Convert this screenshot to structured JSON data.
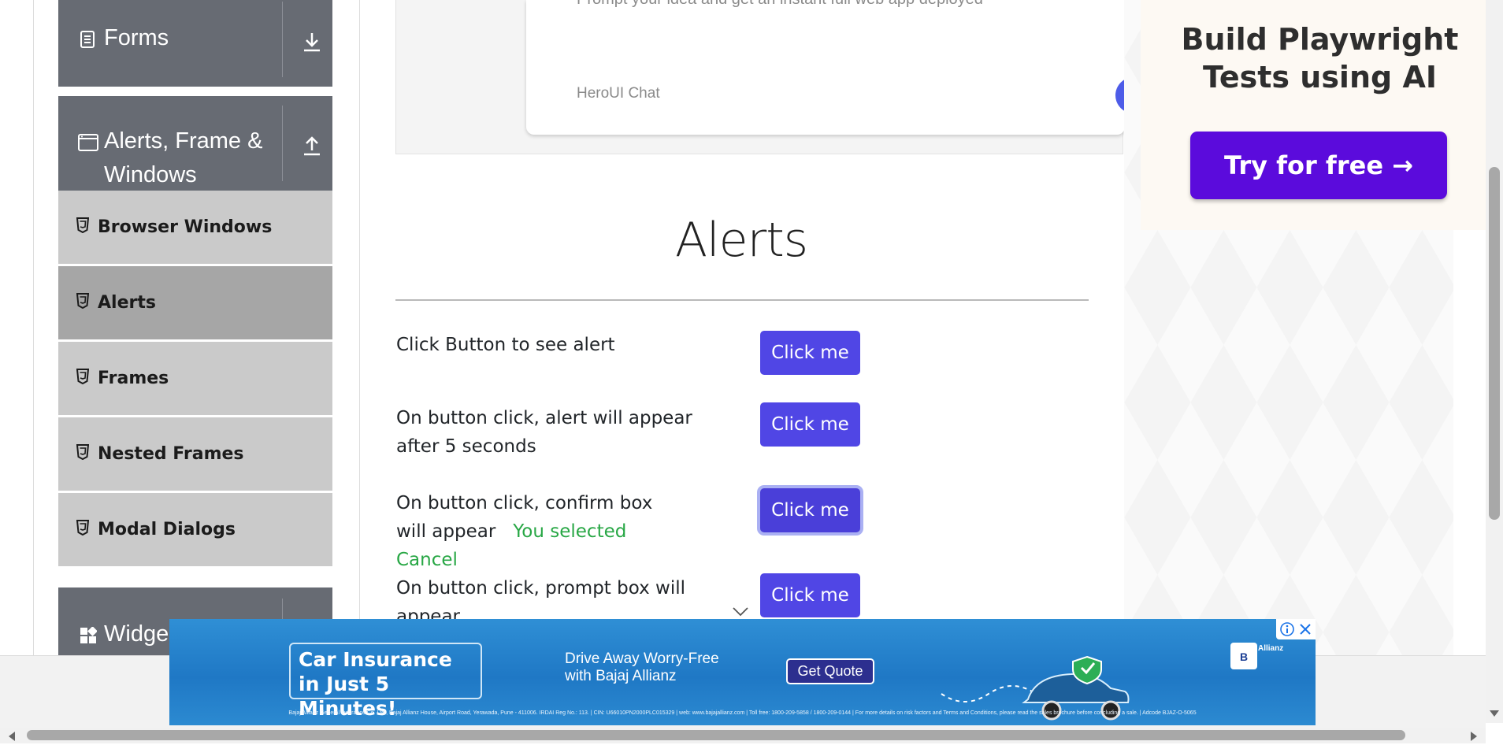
{
  "sidebar": {
    "groups": [
      {
        "label": "Forms"
      },
      {
        "label_line1": "Alerts, Frame &",
        "label_line2": "Windows"
      },
      {
        "label": "Widge"
      }
    ],
    "items": [
      {
        "label": "Browser Windows"
      },
      {
        "label": "Alerts"
      },
      {
        "label": "Frames"
      },
      {
        "label": "Nested Frames"
      },
      {
        "label": "Modal Dialogs"
      }
    ]
  },
  "chat_card": {
    "prompt": "Prompt your idea and get an instant full web app deployed",
    "brand": "HeroUI Chat"
  },
  "main": {
    "heading": "Alerts",
    "rows": [
      {
        "text": "Click Button to see alert",
        "button": "Click me"
      },
      {
        "text": "On button click, alert will appear after 5 seconds",
        "button": "Click me"
      },
      {
        "text": "On button click, confirm box will appear",
        "result": "You selected Cancel",
        "button": "Click me"
      },
      {
        "text": "On button click, prompt box will appear",
        "button": "Click me"
      }
    ]
  },
  "right_ad": {
    "title": "Build Playwright Tests using AI",
    "cta": "Try for free →"
  },
  "bottom_ad": {
    "headline_line1": "Car Insurance",
    "headline_line2": "in Just 5 Minutes!",
    "sub_line1": "Drive Away Worry-Free",
    "sub_line2": "with Bajaj Allianz",
    "cta": "Get Quote",
    "brand": "Allianz",
    "fine_print": "Bajaj Allianz General Insurance Co. Ltd., Bajaj Allianz House, Airport Road, Yerawada, Pune - 411006. IRDAI Reg No.: 113. | CIN: U66010PN2000PLC015329 | web: www.bajajallianz.com | Toll free: 1800-209-5858 / 1800-209-0144 | For more details on risk factors and Terms and Conditions, please read the sales brochure before concluding a sale. | Adcode BJAZ-O-5065"
  },
  "colors": {
    "accent_button": "#5046e5",
    "sidebar_group": "#676b73",
    "sidebar_item": "#cacaca",
    "sidebar_item_active": "#a6a6a6",
    "success_text": "#28a745",
    "ad_cta": "#5b0bdc"
  }
}
